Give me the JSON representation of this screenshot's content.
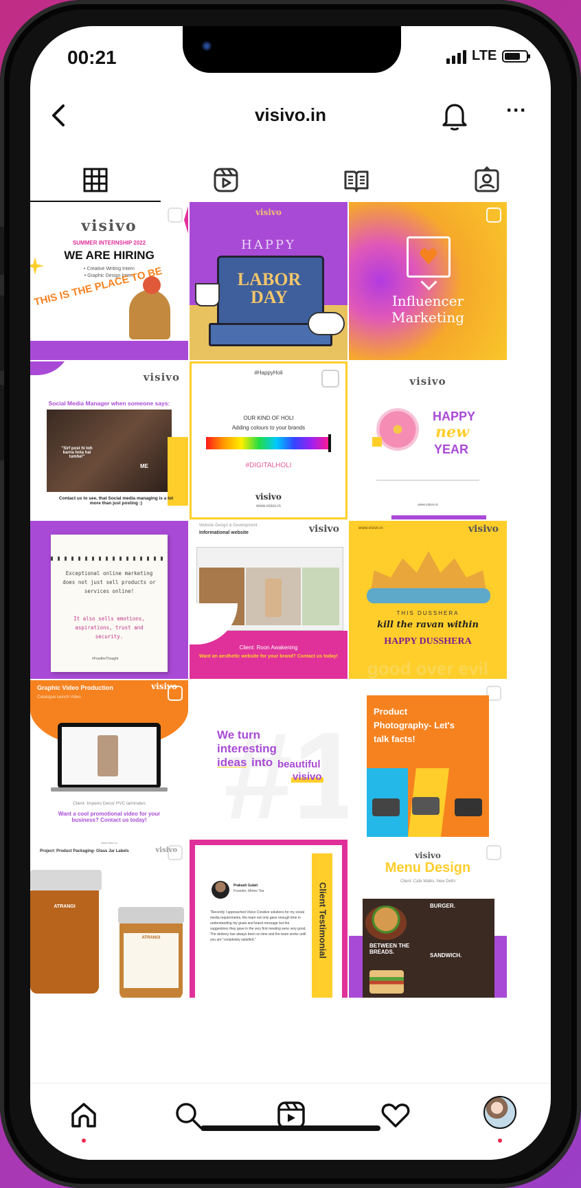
{
  "status": {
    "time": "00:21",
    "network": "LTE"
  },
  "header": {
    "title": "visivo.in"
  },
  "tabs": [
    {
      "name": "posts-grid",
      "icon": "grid-icon"
    },
    {
      "name": "reels",
      "icon": "reels-icon"
    },
    {
      "name": "guides",
      "icon": "guides-icon"
    },
    {
      "name": "tagged",
      "icon": "tagged-icon"
    }
  ],
  "posts": [
    {
      "brand": "visivo",
      "sub": "SUMMER INTERNSHIP 2022",
      "title": "WE ARE HIRING",
      "b1": "• Creative Writing Intern",
      "b2": "• Graphic Design Intern",
      "curve": "THIS IS THE PLACE TO BE"
    },
    {
      "brand": "visivo",
      "top": "HAPPY",
      "main": "LABOR DAY"
    },
    {
      "text1": "Influencer",
      "text2": "Marketing"
    },
    {
      "brand": "visivo",
      "title": "Social Media Manager when someone says:",
      "quote": "\"Sirf post hi toh karna hota hai tumhe!\"",
      "me": "ME",
      "footer": "Contact us to see, that Social media managing is a lot more than just posting :)"
    },
    {
      "tag": "#HappyHoli",
      "l1": "OUR KIND OF HOLI",
      "l2": "Adding colours to your brands",
      "hashtag": "#DIGITALHOLI",
      "brand": "visivo",
      "site": "www.visivo.in"
    },
    {
      "brand": "visivo",
      "happy": "HAPPY",
      "new": "new",
      "year": "YEAR",
      "site": "www.visivo.in"
    },
    {
      "note1": "Exceptional online marketing does not just sell products or services online!",
      "note2": "It also sells emotions, aspirations, trust and security.",
      "hash": "#FoodforThought"
    },
    {
      "head": "Website Design & Development",
      "sub": "Informational website",
      "brand": "visivo",
      "client": "Client: Roon Awakening",
      "cta": "Want an aesthetic website for your brand? Contact us today!"
    },
    {
      "site": "www.visivo.in",
      "brand": "visivo",
      "l1": "THIS DUSSHERA",
      "l2": "kill the ravan within",
      "l3": "HAPPY DUSSHERA",
      "bg": "good over evil"
    },
    {
      "title": "Graphic Video Production",
      "sub": "Catalogue launch Video",
      "brand": "visivo",
      "client": "Client: Imperio Decor PVC laminates",
      "cta": "Want a cool promotional video for your business? Contact us today!"
    },
    {
      "l1": "We turn",
      "l2": "interesting",
      "l3": "ideas",
      "l4": "into",
      "l5": "beautiful",
      "brand": "visivo"
    },
    {
      "title": "Product Photography- Let's talk facts!"
    },
    {
      "site": "www.visivo.in",
      "title": "Project: Product Packaging- Glass Jar Labels",
      "brand": "visivo",
      "label1": "ATRANGI",
      "label2": "ATRANGI"
    },
    {
      "name": "Prakash Gulati",
      "role": "Founder, Meteo Tea",
      "quote": "\"Recently I approached Visivo Creative solutions for my social media requirements, the team not only gave enough time in understanding my goals and brand message but the suggestions they gave in the very first meeting were very good. The delivery has always been on time and the team works until you are \"completely satisfied.\"",
      "side": "Client Testimonial"
    },
    {
      "brand": "visivo",
      "title": "Menu Design",
      "client": "Client: Cafe Walks, New Delhi",
      "burger": "BURGER.",
      "between": "BETWEEN THE BREADS.",
      "sandwich": "SANDWICH."
    }
  ],
  "bottom_nav": [
    "home",
    "search",
    "reels",
    "activity",
    "profile"
  ],
  "colors": {
    "brand_purple": "#a94ad6",
    "brand_yellow": "#ffce2b",
    "brand_orange": "#f6821f",
    "brand_pink": "#e0309a"
  }
}
